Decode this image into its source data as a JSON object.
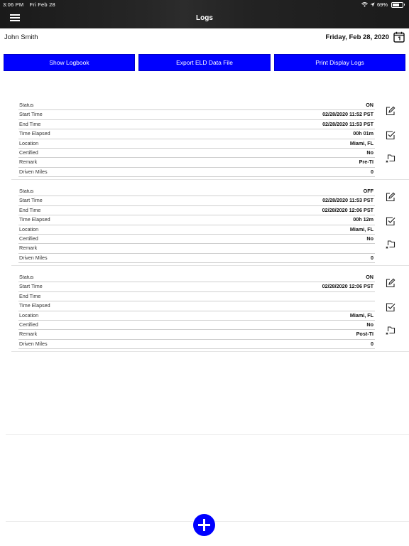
{
  "status_bar": {
    "time": "3:06 PM",
    "date": "Fri Feb 28",
    "battery": "69%",
    "battery_level": 0.69
  },
  "header": {
    "title": "Logs"
  },
  "info": {
    "driver": "John Smith",
    "date": "Friday, Feb 28, 2020"
  },
  "buttons": {
    "show_logbook": "Show Logbook",
    "export_eld": "Export ELD Data File",
    "print_display": "Print Display Logs"
  },
  "labels": {
    "status": "Status",
    "start_time": "Start Time",
    "end_time": "End Time",
    "time_elapsed": "Time Elapsed",
    "location": "Location",
    "certified": "Certified",
    "remark": "Remark",
    "driven_miles": "Driven Miles"
  },
  "logs": [
    {
      "status": "ON",
      "start_time": "02/28/2020 11:52 PST",
      "end_time": "02/28/2020 11:53 PST",
      "time_elapsed": "00h 01m",
      "location": "Miami, FL",
      "certified": "No",
      "remark": "Pre-TI",
      "driven_miles": "0"
    },
    {
      "status": "OFF",
      "start_time": "02/28/2020 11:53 PST",
      "end_time": "02/28/2020 12:06 PST",
      "time_elapsed": "00h 12m",
      "location": "Miami, FL",
      "certified": "No",
      "remark": "",
      "driven_miles": "0"
    },
    {
      "status": "ON",
      "start_time": "02/28/2020 12:06 PST",
      "end_time": "",
      "time_elapsed": "",
      "location": "Miami, FL",
      "certified": "No",
      "remark": "Post-TI",
      "driven_miles": "0"
    }
  ]
}
